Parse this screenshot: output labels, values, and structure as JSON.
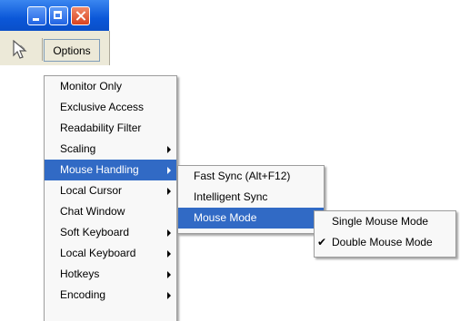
{
  "window": {
    "controls": [
      "minimize-icon",
      "maximize-icon",
      "close-icon"
    ],
    "accent": "#0b57d8"
  },
  "toolbar": {
    "cursor_icon": "pointer-cursor-icon",
    "options_label": "Options"
  },
  "menu": {
    "highlight_color": "#316ac5",
    "items": [
      {
        "label": "Monitor Only",
        "submenu": false
      },
      {
        "label": "Exclusive Access",
        "submenu": false
      },
      {
        "label": "Readability Filter",
        "submenu": false
      },
      {
        "label": "Scaling",
        "submenu": true
      },
      {
        "label": "Mouse Handling",
        "submenu": true,
        "active": true
      },
      {
        "label": "Local Cursor",
        "submenu": true
      },
      {
        "label": "Chat Window",
        "submenu": false
      },
      {
        "label": "Soft Keyboard",
        "submenu": true
      },
      {
        "label": "Local Keyboard",
        "submenu": true
      },
      {
        "label": "Hotkeys",
        "submenu": true
      },
      {
        "label": "Encoding",
        "submenu": true
      }
    ]
  },
  "mouse_handling": {
    "items": [
      {
        "label": "Fast Sync (Alt+F12)",
        "submenu": false
      },
      {
        "label": "Intelligent Sync",
        "submenu": false
      },
      {
        "label": "Mouse Mode",
        "submenu": true,
        "active": true
      }
    ]
  },
  "mouse_mode": {
    "items": [
      {
        "label": "Single Mouse Mode",
        "checked": false
      },
      {
        "label": "Double Mouse Mode",
        "checked": true
      }
    ],
    "check_glyph": "✔"
  }
}
